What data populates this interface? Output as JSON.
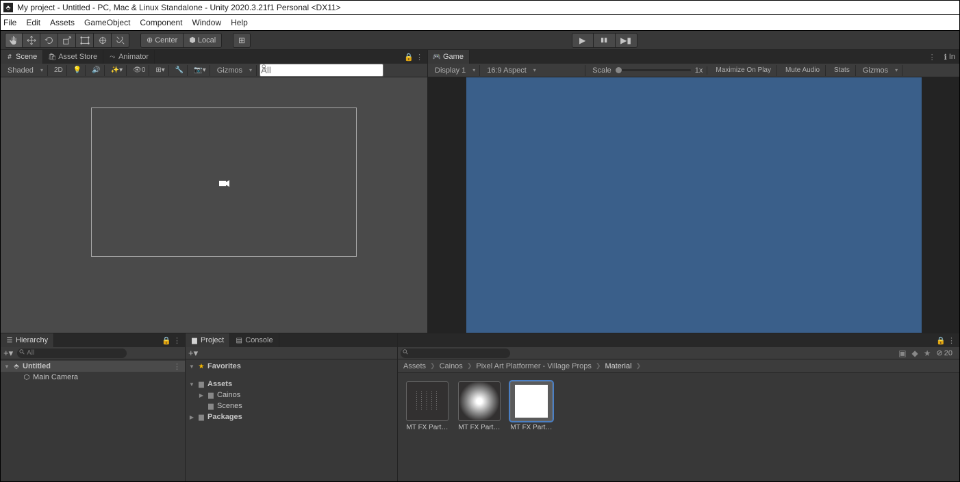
{
  "title": "My project - Untitled - PC, Mac & Linux Standalone - Unity 2020.3.21f1 Personal <DX11>",
  "menu": [
    "File",
    "Edit",
    "Assets",
    "GameObject",
    "Component",
    "Window",
    "Help"
  ],
  "toolbar": {
    "center": "Center",
    "local": "Local"
  },
  "play": {
    "play": "▶",
    "pause": "❚❚",
    "step": "▶❙"
  },
  "scene": {
    "tabs": [
      "Scene",
      "Asset Store",
      "Animator"
    ],
    "shading": "Shaded",
    "dim": "2D",
    "gizmos": "Gizmos",
    "search_ph": "All",
    "vis_count": "0"
  },
  "game": {
    "tab": "Game",
    "display": "Display 1",
    "aspect": "16:9 Aspect",
    "scale": "Scale",
    "scale_val": "1x",
    "max": "Maximize On Play",
    "mute": "Mute Audio",
    "stats": "Stats",
    "gizmos": "Gizmos",
    "in": "In"
  },
  "hierarchy": {
    "tab": "Hierarchy",
    "search_ph": "All",
    "scene": "Untitled",
    "items": [
      "Main Camera"
    ]
  },
  "project": {
    "tab": "Project",
    "console": "Console",
    "fav": "Favorites",
    "assets": "Assets",
    "cainos": "Cainos",
    "scenes": "Scenes",
    "packages": "Packages",
    "hidden_count": "20"
  },
  "breadcrumb": [
    "Assets",
    "Cainos",
    "Pixel Art Platformer - Village Props",
    "Material"
  ],
  "assets": {
    "items": [
      {
        "name": "MT FX Part…"
      },
      {
        "name": "MT FX Part…"
      },
      {
        "name": "MT FX Part…"
      }
    ]
  }
}
